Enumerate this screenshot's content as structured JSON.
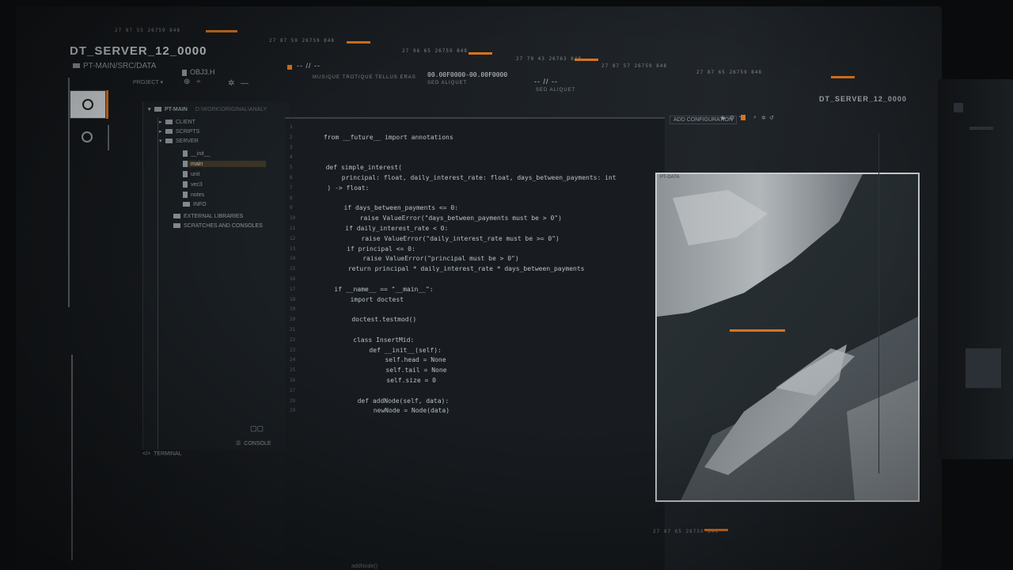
{
  "top_strip": {
    "group1": "27  87  55  26759  848",
    "group2": "27  87  59  26759  848",
    "group3": "27  96  65  26759  848",
    "group4": "27  79  43  26763  848",
    "group5": "27  87  57  26759  848",
    "group6": "27  87  65  26759  848",
    "playback1": "-- // --",
    "playback2": "-- // --",
    "timecode": "00.00F0000-00.00F0000",
    "caption1": "MUSIQUE TROTIQUE TELLUS ERAS",
    "caption2": "SED ALIQUET",
    "caption3": "SED ALIQUET"
  },
  "header": {
    "server_title": "DT_SERVER_12_0000",
    "path": "PT-MAIN/SRC/DATA",
    "open_file": "OBJ3.H",
    "project_label": "PROJECT ▾"
  },
  "tree": {
    "root": "PT-MAIN",
    "root_path": "D:\\WORK\\ORIGINAL\\ANALY",
    "items": [
      {
        "label": "CLIENT",
        "type": "folder"
      },
      {
        "label": "SCRIPTS",
        "type": "folder"
      },
      {
        "label": "SERVER",
        "type": "folder"
      },
      {
        "label": "__init__",
        "type": "file"
      },
      {
        "label": "main",
        "type": "file"
      },
      {
        "label": "unit",
        "type": "file"
      },
      {
        "label": "vec3",
        "type": "file"
      },
      {
        "label": "notes",
        "type": "file"
      },
      {
        "label": "INFO",
        "type": "folder"
      },
      {
        "label": "EXTERNAL LIBRARIES",
        "type": "lib"
      },
      {
        "label": "SCRATCHES AND CONSOLES",
        "type": "lib"
      }
    ]
  },
  "bottom_tabs": {
    "terminal": "TERMINAL",
    "console": "CONSOLE"
  },
  "editor": {
    "toolbar_label": "ADD CONFIGURATION",
    "lines": [
      {
        "n": "1",
        "code": ""
      },
      {
        "n": "2",
        "code": "from __future__ import annotations"
      },
      {
        "n": "3",
        "code": ""
      },
      {
        "n": "4",
        "code": ""
      },
      {
        "n": "5",
        "code": "def simple_interest("
      },
      {
        "n": "6",
        "code": "    principal: float, daily_interest_rate: float, days_between_payments: int"
      },
      {
        "n": "7",
        "code": ") -> float:"
      },
      {
        "n": "8",
        "code": ""
      },
      {
        "n": "9",
        "code": "    if days_between_payments <= 0:"
      },
      {
        "n": "10",
        "code": "        raise ValueError(\"days_between_payments must be > 0\")"
      },
      {
        "n": "11",
        "code": "    if daily_interest_rate < 0:"
      },
      {
        "n": "12",
        "code": "        raise ValueError(\"daily_interest_rate must be >= 0\")"
      },
      {
        "n": "13",
        "code": "    if principal <= 0:"
      },
      {
        "n": "14",
        "code": "        raise ValueError(\"principal must be > 0\")"
      },
      {
        "n": "15",
        "code": "    return principal * daily_interest_rate * days_between_payments"
      },
      {
        "n": "16",
        "code": ""
      },
      {
        "n": "17",
        "code": "if __name__ == \"__main__\":"
      },
      {
        "n": "18",
        "code": "    import doctest"
      },
      {
        "n": "19",
        "code": ""
      },
      {
        "n": "20",
        "code": "    doctest.testmod()"
      },
      {
        "n": "21",
        "code": ""
      },
      {
        "n": "22",
        "code": "    class InsertMid:"
      },
      {
        "n": "23",
        "code": "        def __init__(self):"
      },
      {
        "n": "24",
        "code": "            self.head = None"
      },
      {
        "n": "25",
        "code": "            self.tail = None"
      },
      {
        "n": "26",
        "code": "            self.size = 0"
      },
      {
        "n": "27",
        "code": ""
      },
      {
        "n": "28",
        "code": "    def addNode(self, data):"
      },
      {
        "n": "29",
        "code": "        newNode = Node(data)"
      }
    ],
    "footer": "addNode()"
  },
  "image_panel": {
    "title": "PT-DATA"
  },
  "right_panel": {
    "title": "DT_SERVER_12_0000"
  },
  "status_bottom": "27  87  65  26759  848",
  "colors": {
    "accent": "#d7741f",
    "bg": "#181c20",
    "text": "#b8c0c6"
  }
}
